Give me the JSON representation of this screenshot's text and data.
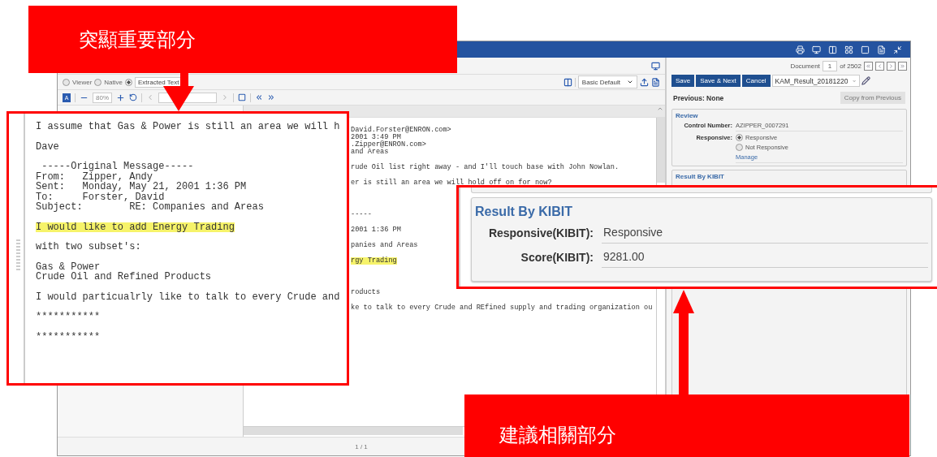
{
  "viewer": {
    "modes": [
      {
        "label": "Viewer",
        "selected": false
      },
      {
        "label": "Native",
        "selected": false
      },
      {
        "label": "Extracted Text",
        "selected": true
      }
    ],
    "layout": "Basic Default",
    "font_button": "A",
    "zoom": "80%",
    "sections": [
      {
        "paragraphs": [
          {
            "lines": [
              "David.Forster@ENRON.com>",
              "2001 3:49 PM",
              ".Zipper@ENRON.com>",
              "and Areas"
            ],
            "highlighted": false
          },
          {
            "lines": [
              "rude Oil list right away - and I'll touch base with John Nowlan."
            ],
            "highlighted": false
          },
          {
            "lines": [
              "er is still an area we will hold off on for now?"
            ],
            "highlighted": false
          }
        ]
      },
      {
        "paragraphs": [
          {
            "lines": [
              "-----"
            ],
            "highlighted": false
          },
          {
            "lines": [
              "2001 1:36 PM"
            ],
            "highlighted": false
          },
          {
            "lines": [
              "panies and Areas"
            ],
            "highlighted": false
          },
          {
            "lines": [
              "rgy Trading"
            ],
            "highlighted": true
          }
        ]
      },
      {
        "paragraphs": [
          {
            "lines": [
              "roducts"
            ],
            "highlighted": false
          },
          {
            "lines": [
              "ke to talk to every Crude and REfined supply and trading organization ou"
            ],
            "highlighted": false
          }
        ]
      }
    ],
    "page": "1 / 1"
  },
  "panel": {
    "document_label": "Document",
    "document_number": "1",
    "document_total": "of 2502",
    "buttons": [
      "Save",
      "Save & Next",
      "Cancel"
    ],
    "layout": "KAM_Result_20181220",
    "previous": "Previous: None",
    "copy_button": {
      "label": "Copy from Previous",
      "disabled": true
    },
    "review": {
      "title": "Review",
      "control_label": "Control Number:",
      "control_value": "AZIPPER_0007291",
      "responsive_label": "Responsive:",
      "options": [
        {
          "label": "Responsive",
          "selected": true
        },
        {
          "label": "Not Responsive",
          "selected": false
        }
      ],
      "manage": "Manage"
    },
    "result_title": "Result By KIBIT"
  },
  "highlight_callout": {
    "label": "突顯重要部分",
    "paragraphs": [
      {
        "lines": [
          "I assume that Gas & Power is still an area we will h"
        ],
        "highlighted": false
      },
      {
        "lines": [
          "Dave"
        ],
        "highlighted": false
      },
      {
        "lines": [
          " -----Original Message-----",
          "From:   Zipper, Andy",
          "Sent:   Monday, May 21, 2001 1:36 PM",
          "To:     Forster, David",
          "Subject:        RE: Companies and Areas"
        ],
        "highlighted": false
      },
      {
        "lines": [
          "I would like to add Energy Trading"
        ],
        "highlighted": true
      },
      {
        "lines": [
          "with two subset's:"
        ],
        "highlighted": false
      },
      {
        "lines": [
          "Gas & Power",
          "Crude Oil and Refined Products"
        ],
        "highlighted": false
      },
      {
        "lines": [
          "I would particualrly like to talk to every Crude and"
        ],
        "highlighted": false
      },
      {
        "lines": [
          "***********"
        ],
        "highlighted": false
      },
      {
        "lines": [
          "***********"
        ],
        "highlighted": false
      }
    ]
  },
  "suggest_callout": {
    "label": "建議相關部分",
    "title": "Result By KIBIT",
    "fields": [
      {
        "label": "Responsive(KIBIT):",
        "value": "Responsive"
      },
      {
        "label": "Score(KIBIT):",
        "value": "9281.00"
      }
    ]
  }
}
